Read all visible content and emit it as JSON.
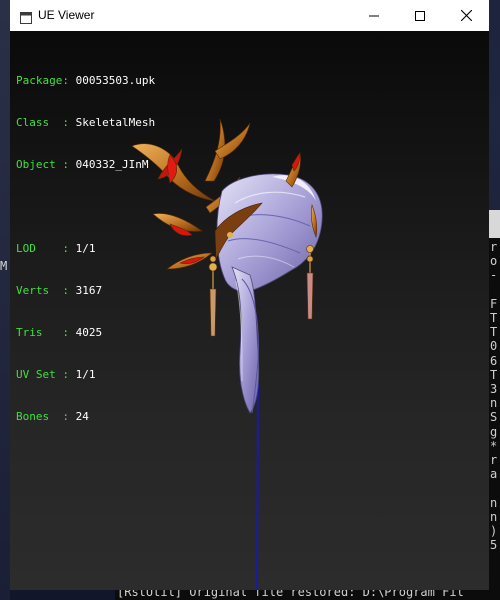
{
  "window": {
    "title": "UE Viewer"
  },
  "info": {
    "package_label": "Package: ",
    "package": "00053503.upk",
    "class_label": "Class  : ",
    "class": "SkeletalMesh",
    "object_label": "Object : ",
    "object": "040332_JInM",
    "lod_label": "LOD    : ",
    "lod": "1/1",
    "verts_label": "Verts  : ",
    "verts": "3167",
    "tris_label": "Tris   : ",
    "tris": "4025",
    "uvset_label": "UV Set : ",
    "uvset": "1/1",
    "bones_label": "Bones  : ",
    "bones": "24"
  },
  "background": {
    "left_char": "M",
    "console_lines": "r\no\n-\n\nF\nT\nT\n0\n6\nT\n3\nn\nS\ng\n*\nr\na\n\nn\nn\n)\n5",
    "console_bottom": "[RstUtil] Original file restored: D:\\Program Fil"
  },
  "icons": {
    "app": "app-window-icon",
    "minimize": "minimize-icon",
    "maximize": "maximize-icon",
    "close": "close-icon"
  },
  "colors": {
    "label_green": "#3fe03f",
    "value_white": "#ffffff",
    "titlebar": "#ffffff",
    "axis_blue": "#1a1aa8"
  }
}
